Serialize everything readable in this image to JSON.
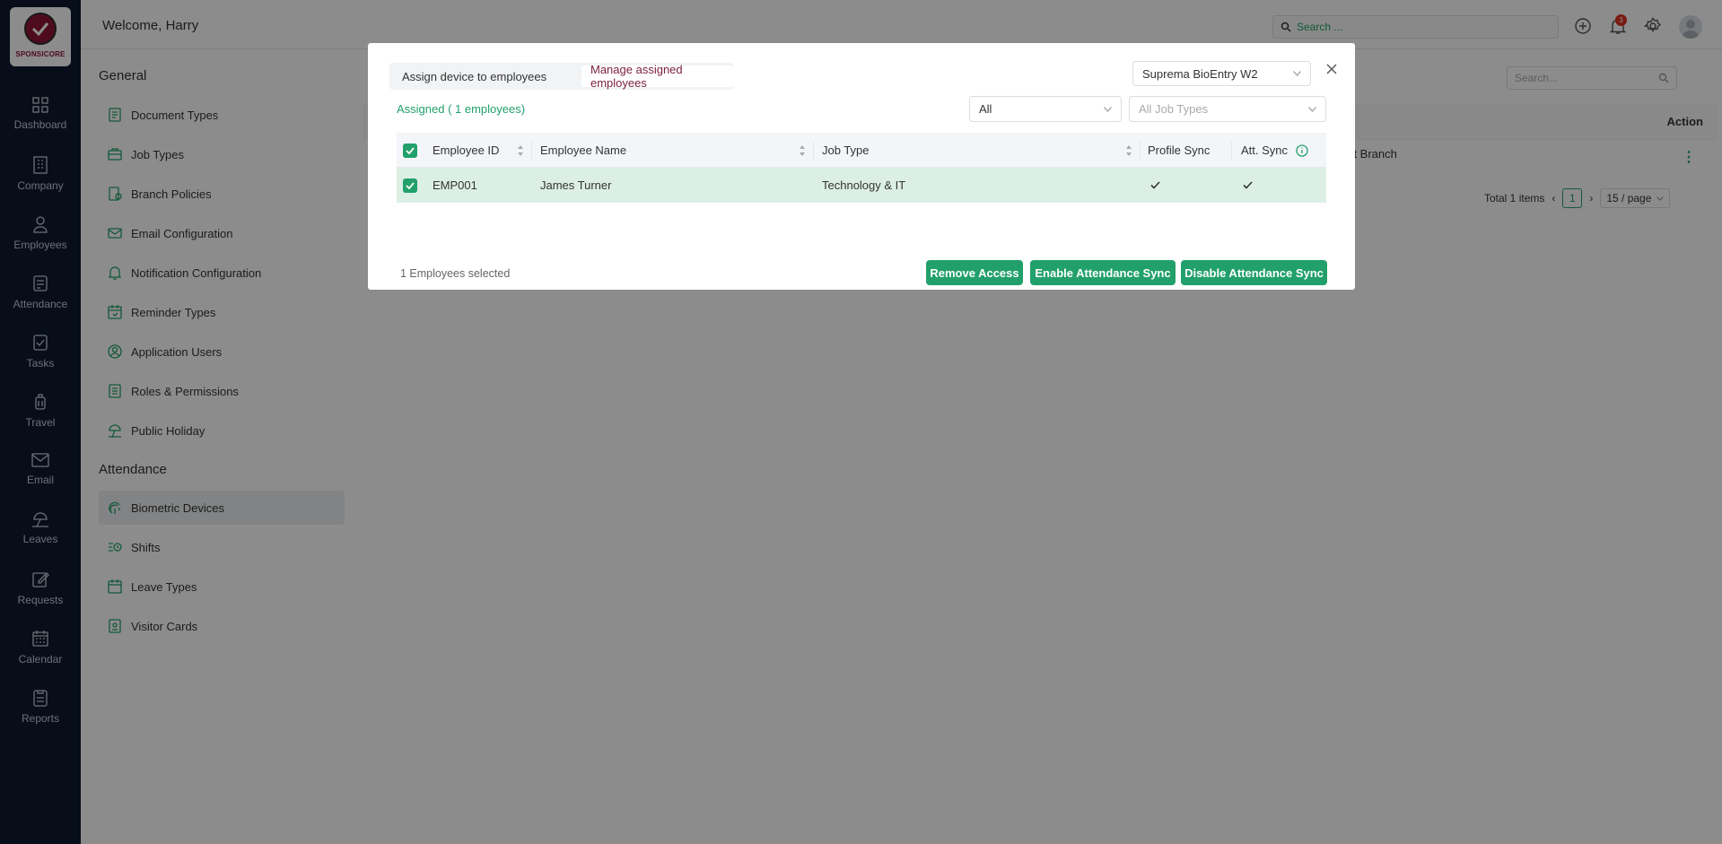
{
  "app": {
    "brand": "SPONSICORE",
    "welcome": "Welcome, Harry"
  },
  "left_nav": [
    {
      "label": "Dashboard",
      "icon": "dashboard-icon"
    },
    {
      "label": "Company",
      "icon": "building-icon"
    },
    {
      "label": "Employees",
      "icon": "user-icon"
    },
    {
      "label": "Attendance",
      "icon": "attendance-icon"
    },
    {
      "label": "Tasks",
      "icon": "tasks-icon"
    },
    {
      "label": "Travel",
      "icon": "luggage-icon"
    },
    {
      "label": "Email",
      "icon": "mail-icon"
    },
    {
      "label": "Leaves",
      "icon": "beach-icon"
    },
    {
      "label": "Requests",
      "icon": "edit-icon"
    },
    {
      "label": "Calendar",
      "icon": "calendar-icon"
    },
    {
      "label": "Reports",
      "icon": "report-icon"
    }
  ],
  "topbar": {
    "search_placeholder": "Search ...",
    "notification_count": "3"
  },
  "settings_menu": {
    "general_title": "General",
    "general_items": [
      "Document Types",
      "Job Types",
      "Branch Policies",
      "Email Configuration",
      "Notification Configuration",
      "Reminder Types",
      "Application Users",
      "Roles & Permissions",
      "Public Holiday"
    ],
    "attendance_title": "Attendance",
    "attendance_items": [
      "Biometric Devices",
      "Shifts",
      "Leave Types",
      "Visitor Cards"
    ],
    "active_item": "Biometric Devices"
  },
  "background_table": {
    "search_placeholder": "Search...",
    "action_header": "Action",
    "row_branch": "ent Branch",
    "total": "Total 1 items",
    "page": "1",
    "page_size": "15 / page"
  },
  "modal": {
    "tabs": [
      "Assign device to employees",
      "Manage assigned employees"
    ],
    "selected_tab": "Manage assigned employees",
    "device": "Suprema BioEntry W2",
    "assigned_label": "Assigned ( 1 employees)",
    "filter_status": "All",
    "filter_job_type_placeholder": "All Job Types",
    "columns": {
      "employee_id": "Employee ID",
      "employee_name": "Employee Name",
      "job_type": "Job Type",
      "profile_sync": "Profile Sync",
      "att_sync": "Att. Sync"
    },
    "rows": [
      {
        "employee_id": "EMP001",
        "employee_name": "James Turner",
        "job_type": "Technology & IT",
        "profile_sync": true,
        "att_sync": true,
        "selected": true
      }
    ],
    "selected_count": "1 Employees selected",
    "buttons": {
      "remove": "Remove Access",
      "enable": "Enable Attendance Sync",
      "disable": "Disable Attendance Sync"
    }
  },
  "colors": {
    "accent": "#22a06b",
    "brand": "#8e1538",
    "nav_bg": "#0d1b2f",
    "selected_row": "#dcefe4"
  }
}
